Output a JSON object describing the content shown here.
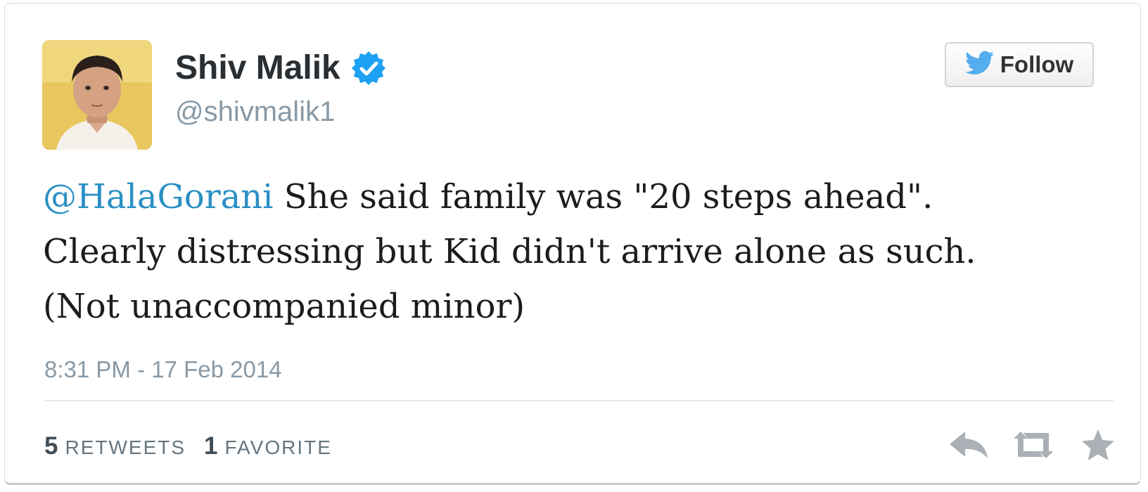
{
  "author": {
    "display_name": "Shiv Malik",
    "handle": "@shivmalik1",
    "verified": true
  },
  "follow_button": {
    "label": "Follow"
  },
  "tweet": {
    "mention": "@HalaGorani",
    "text_line1": " She said family was \"20 steps ahead\".",
    "text_line2": "Clearly distressing but Kid didn't arrive alone as such.",
    "text_line3": "(Not unaccompanied minor)",
    "timestamp": "8:31 PM - 17 Feb 2014"
  },
  "stats": {
    "retweets_count": "5",
    "retweets_label": "RETWEETS",
    "favorites_count": "1",
    "favorites_label": "FAVORITE"
  },
  "actions": {
    "icons": [
      "reply-icon",
      "retweet-icon",
      "favorite-icon"
    ]
  },
  "colors": {
    "mention_blue": "#2b8fc4",
    "verified_blue": "#1da1f2",
    "twitter_bird_blue": "#55acee",
    "muted_gray": "#8899a6",
    "action_icon_gray": "#aab0b5"
  }
}
